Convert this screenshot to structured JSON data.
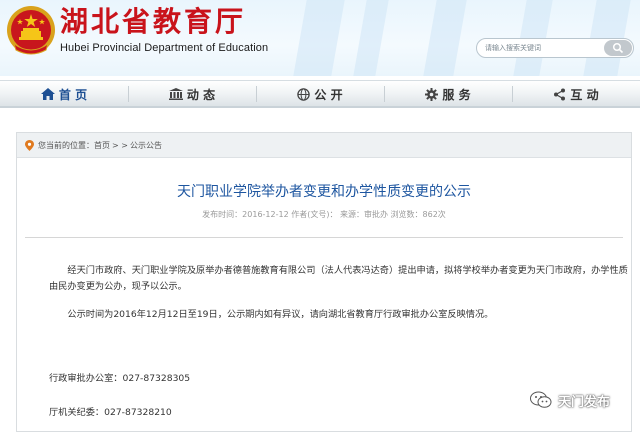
{
  "header": {
    "site_title": "湖北省教育厅",
    "site_subtitle": "Hubei Provincial Department of Education",
    "search_placeholder": "请输入搜索关键词"
  },
  "nav": {
    "items": [
      {
        "label": "首 页",
        "icon": "home-icon"
      },
      {
        "label": "动 态",
        "icon": "building-icon"
      },
      {
        "label": "公 开",
        "icon": "globe-icon"
      },
      {
        "label": "服 务",
        "icon": "gear-icon"
      },
      {
        "label": "互 动",
        "icon": "share-icon"
      }
    ]
  },
  "breadcrumb": {
    "prefix": "您当前的位置：",
    "home": "首页",
    "sep1": " > > ",
    "current": "公示公告"
  },
  "article": {
    "title": "天门职业学院举办者变更和办学性质变更的公示",
    "meta": "发布时间：2016-12-12 作者(文号)：  来源：审批办  浏览数：862次",
    "paragraph_1": "经天门市政府、天门职业学院及原举办者德普施教育有限公司（法人代表冯达奇）提出申请，拟将学校举办者变更为天门市政府，办学性质由民办变更为公办，现予以公示。",
    "paragraph_2": "公示时间为2016年12月12日至19日，公示期内如有异议，请向湖北省教育厅行政审批办公室反映情况。",
    "contact_1": "行政审批办公室：027-87328305",
    "contact_2": "厅机关纪委：027-87328210"
  },
  "watermark": {
    "text": "天门发布",
    "icon": "wechat-icon"
  },
  "colors": {
    "title_red": "#c9131b",
    "article_blue": "#1e56a0",
    "nav_active": "#1d4f93"
  }
}
